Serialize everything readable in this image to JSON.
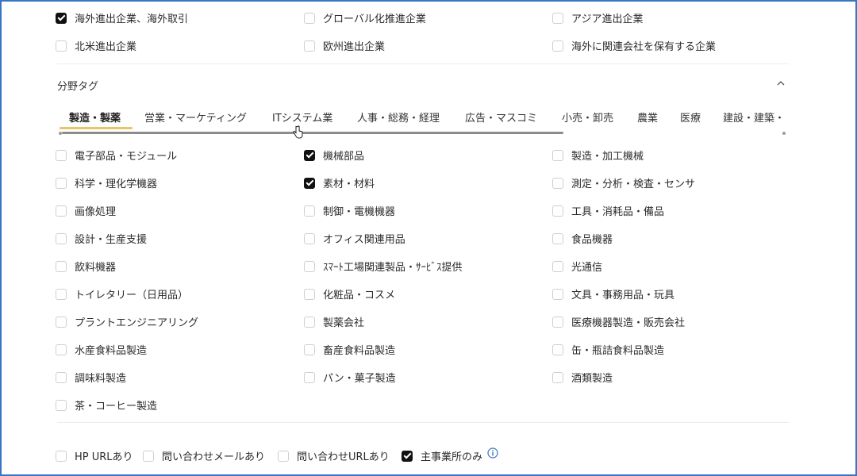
{
  "region_options": [
    {
      "label": "海外進出企業、海外取引",
      "checked": true
    },
    {
      "label": "グローバル化推進企業",
      "checked": false
    },
    {
      "label": "アジア進出企業",
      "checked": false
    },
    {
      "label": "北米進出企業",
      "checked": false
    },
    {
      "label": "欧州進出企業",
      "checked": false
    },
    {
      "label": "海外に関連会社を保有する企業",
      "checked": false
    }
  ],
  "field_tags": {
    "title": "分野タグ",
    "tabs": [
      "製造・製薬",
      "営業・マーケティング",
      "ITシステム業",
      "人事・総務・経理",
      "広告・マスコミ",
      "小売・卸売",
      "農業",
      "医療",
      "建設・建築・"
    ],
    "active_tab": 0,
    "options": [
      {
        "label": "電子部品・モジュール",
        "checked": false
      },
      {
        "label": "機械部品",
        "checked": true
      },
      {
        "label": "製造・加工機械",
        "checked": false
      },
      {
        "label": "科学・理化学機器",
        "checked": false
      },
      {
        "label": "素材・材料",
        "checked": true
      },
      {
        "label": "測定・分析・検査・センサ",
        "checked": false
      },
      {
        "label": "画像処理",
        "checked": false
      },
      {
        "label": "制御・電機機器",
        "checked": false
      },
      {
        "label": "工具・消耗品・備品",
        "checked": false
      },
      {
        "label": "設計・生産支援",
        "checked": false
      },
      {
        "label": "オフィス関連用品",
        "checked": false
      },
      {
        "label": "食品機器",
        "checked": false
      },
      {
        "label": "飲料機器",
        "checked": false
      },
      {
        "label": "ｽﾏｰﾄ工場関連製品・ｻｰﾋﾞｽ提供",
        "checked": false
      },
      {
        "label": "光通信",
        "checked": false
      },
      {
        "label": "トイレタリー（日用品）",
        "checked": false
      },
      {
        "label": "化粧品・コスメ",
        "checked": false
      },
      {
        "label": "文具・事務用品・玩具",
        "checked": false
      },
      {
        "label": "プラントエンジニアリング",
        "checked": false
      },
      {
        "label": "製薬会社",
        "checked": false
      },
      {
        "label": "医療機器製造・販売会社",
        "checked": false
      },
      {
        "label": "水産食料品製造",
        "checked": false
      },
      {
        "label": "畜産食料品製造",
        "checked": false
      },
      {
        "label": "缶・瓶詰食料品製造",
        "checked": false
      },
      {
        "label": "調味料製造",
        "checked": false
      },
      {
        "label": "パン・菓子製造",
        "checked": false
      },
      {
        "label": "酒類製造",
        "checked": false
      },
      {
        "label": "茶・コーヒー製造",
        "checked": false
      }
    ]
  },
  "filters": [
    {
      "label": "HP URLあり",
      "checked": false
    },
    {
      "label": "問い合わせメールあり",
      "checked": false
    },
    {
      "label": "問い合わせURLあり",
      "checked": false
    },
    {
      "label": "主事業所のみ",
      "checked": true
    }
  ],
  "icons": {
    "collapse": "chevron-up-icon",
    "info": "info-circle-icon",
    "cursor": "hand-pointer-icon"
  },
  "colors": {
    "accent_underline": "#e8c568",
    "info": "#3a76c3",
    "checked_box": "#111111"
  }
}
